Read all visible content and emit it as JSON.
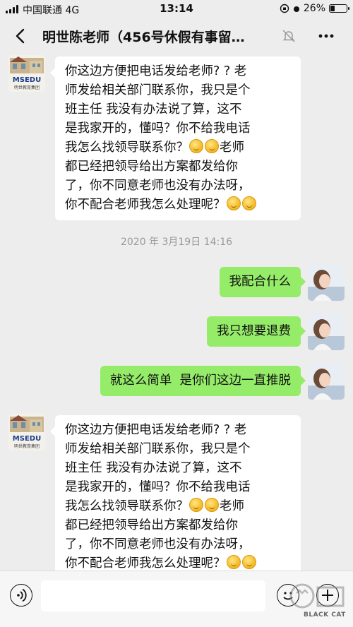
{
  "status_bar": {
    "carrier": "中国联通",
    "network": "4G",
    "time": "13:14",
    "battery": "26%",
    "battery_level": 0.26
  },
  "navbar": {
    "title": "明世陈老师（456号休假有事留…"
  },
  "avatar_school": {
    "logo_text": "MSEDU",
    "caption": "明世教育集团"
  },
  "messages": [
    {
      "side": "in",
      "sender": "school",
      "lines": [
        "你这边方便把电话发给老师? ? 老",
        "师发给相关部门联系你，我只是个",
        "班主任 我没有办法说了算，这不",
        "是我家开的，懂吗？你不给我电话",
        " 我怎么找领导联系你？",
        "都已经把领导给出方案都发给你",
        "了，你不同意老师也没有办法呀，",
        "你不配合老师我怎么处理呢？"
      ],
      "line5_tail": "老师"
    },
    {
      "side": "out",
      "text": "我配合什么"
    },
    {
      "side": "out",
      "text": "我只想要退费"
    },
    {
      "side": "out",
      "text": "就这么简单  是你们这边一直推脱"
    },
    {
      "side": "in",
      "sender": "school",
      "lines": [
        "你这边方便把电话发给老师? ? 老",
        "师发给相关部门联系你，我只是个",
        "班主任 我没有办法说了算，这不",
        "是我家开的，懂吗？你不给我电话",
        " 我怎么找领导联系你？",
        "都已经把领导给出方案都发给你",
        "了，你不同意老师也没有办法呀，",
        "你不配合老师我怎么处理呢？"
      ],
      "line5_tail": "老师"
    }
  ],
  "timestamp": "2020 年 3月19日 14:16",
  "icons": {
    "back": "chevron-left-icon",
    "mute": "bell-muted-icon",
    "more": "more-dots-icon",
    "voice": "voice-icon",
    "emoji": "emoji-icon",
    "plus": "plus-icon",
    "emoji_in_text": "smile-emoji-icon"
  },
  "watermark": {
    "text": "BLACK CAT"
  },
  "colors": {
    "background": "#ededed",
    "outgoing_bubble": "#95ec69",
    "incoming_bubble": "#ffffff"
  }
}
